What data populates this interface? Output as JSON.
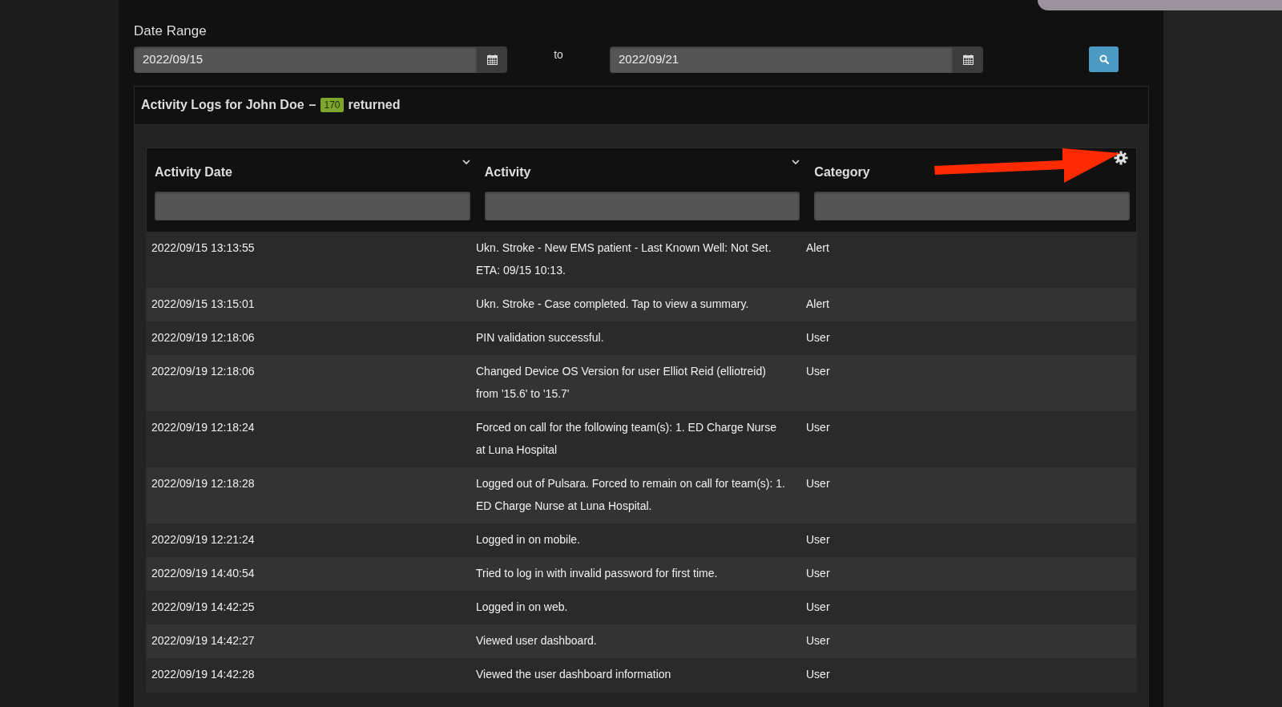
{
  "date_range": {
    "label": "Date Range",
    "from": "2022/09/15",
    "separator": "to",
    "to": "2022/09/21"
  },
  "card": {
    "title": "Activity Logs for John Doe",
    "dash": "–",
    "count": "170",
    "suffix": "returned"
  },
  "table": {
    "columns": [
      {
        "label": "Activity Date",
        "sortable": true
      },
      {
        "label": "Activity",
        "sortable": true
      },
      {
        "label": "Category",
        "sortable": false
      }
    ],
    "rows": [
      {
        "date": "2022/09/15 13:13:55",
        "activity": "Ukn. Stroke - New EMS patient - Last Known Well: Not Set. ETA: 09/15 10:13.",
        "category": "Alert"
      },
      {
        "date": "2022/09/15 13:15:01",
        "activity": "Ukn. Stroke - Case completed. Tap to view a summary.",
        "category": "Alert"
      },
      {
        "date": "2022/09/19 12:18:06",
        "activity": "PIN validation successful.",
        "category": "User"
      },
      {
        "date": "2022/09/19 12:18:06",
        "activity": "Changed Device OS Version for user Elliot Reid (elliotreid) from '15.6' to '15.7'",
        "category": "User"
      },
      {
        "date": "2022/09/19 12:18:24",
        "activity": "Forced on call for the following team(s): 1. ED Charge Nurse at Luna Hospital",
        "category": "User"
      },
      {
        "date": "2022/09/19 12:18:28",
        "activity": "Logged out of Pulsara. Forced to remain on call for team(s): 1. ED Charge Nurse at Luna Hospital.",
        "category": "User"
      },
      {
        "date": "2022/09/19 12:21:24",
        "activity": "Logged in on mobile.",
        "category": "User"
      },
      {
        "date": "2022/09/19 14:40:54",
        "activity": "Tried to log in with invalid password for first time.",
        "category": "User"
      },
      {
        "date": "2022/09/19 14:42:25",
        "activity": "Logged in on web.",
        "category": "User"
      },
      {
        "date": "2022/09/19 14:42:27",
        "activity": "Viewed user dashboard.",
        "category": "User"
      },
      {
        "date": "2022/09/19 14:42:28",
        "activity": "Viewed the user dashboard information",
        "category": "User"
      }
    ]
  }
}
